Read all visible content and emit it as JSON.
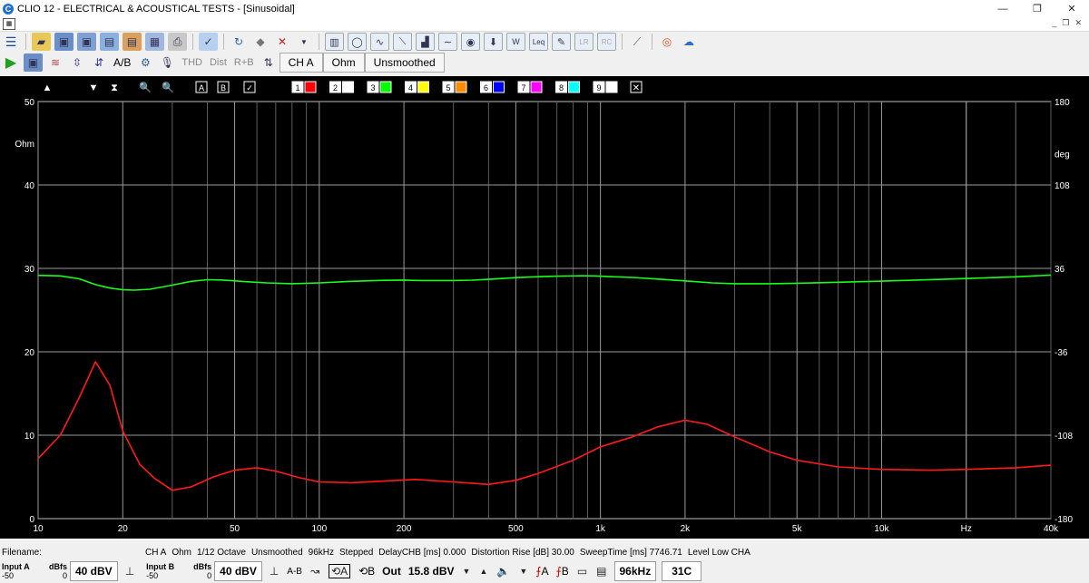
{
  "window": {
    "title": "CLIO 12 - ELECTRICAL & ACOUSTICAL TESTS - [Sinusoidal]",
    "app_icon_letter": "C",
    "minimize": "—",
    "maximize": "❐",
    "close": "✕"
  },
  "toolbar2": {
    "thd": "THD",
    "dist": "Dist",
    "rb": "R+B",
    "channel": "CH A",
    "unit": "Ohm",
    "smoothing": "Unsmoothed",
    "ab_label": "A/B"
  },
  "plot_toolbar": {
    "buttons": [
      "▲",
      "▼",
      "⧗",
      "🔍",
      "🔍",
      "A",
      "B",
      "✓"
    ],
    "overlays": [
      "1",
      "2",
      "3",
      "4",
      "5",
      "6",
      "7",
      "8",
      "9"
    ],
    "overlay_colors": [
      "#ff0000",
      "#ffffff",
      "#00ff00",
      "#ffff00",
      "#ff8c00",
      "#0000ff",
      "#ff00ff",
      "#00ffff",
      "#ffffff"
    ],
    "clear": "✕"
  },
  "chart_data": {
    "type": "line",
    "xscale": "log",
    "xlim": [
      10,
      40000
    ],
    "ylim": [
      0,
      50
    ],
    "y2lim": [
      -180,
      180
    ],
    "ylabel": "Ohm",
    "y2label": "deg",
    "xlabel": "Hz",
    "grid": true,
    "x_ticks": [
      {
        "v": 10,
        "t": "10"
      },
      {
        "v": 20,
        "t": "20"
      },
      {
        "v": 50,
        "t": "50"
      },
      {
        "v": 100,
        "t": "100"
      },
      {
        "v": 200,
        "t": "200"
      },
      {
        "v": 500,
        "t": "500"
      },
      {
        "v": 1000,
        "t": "1k"
      },
      {
        "v": 2000,
        "t": "2k"
      },
      {
        "v": 5000,
        "t": "5k"
      },
      {
        "v": 10000,
        "t": "10k"
      },
      {
        "v": 20000,
        "t": "Hz"
      },
      {
        "v": 40000,
        "t": "40k"
      }
    ],
    "y_ticks": [
      {
        "v": 50,
        "t": "50"
      },
      {
        "v": 45,
        "t": "Ohm"
      },
      {
        "v": 40,
        "t": "40"
      },
      {
        "v": 30,
        "t": "30"
      },
      {
        "v": 20,
        "t": "20"
      },
      {
        "v": 10,
        "t": "10"
      },
      {
        "v": 0,
        "t": "0"
      }
    ],
    "y2_ticks": [
      {
        "v": 180,
        "t": "180"
      },
      {
        "v": 135,
        "t": "deg"
      },
      {
        "v": 108,
        "t": "108"
      },
      {
        "v": 36,
        "t": "36"
      },
      {
        "v": -36,
        "t": "-36"
      },
      {
        "v": -108,
        "t": "-108"
      },
      {
        "v": -180,
        "t": "-180"
      }
    ],
    "series": [
      {
        "axis": "left",
        "color": "#ff1a1a",
        "points": [
          [
            10,
            7.2
          ],
          [
            12,
            10
          ],
          [
            14,
            14.5
          ],
          [
            16,
            18.8
          ],
          [
            18,
            16
          ],
          [
            20,
            10.5
          ],
          [
            23,
            6.5
          ],
          [
            26,
            4.8
          ],
          [
            30,
            3.4
          ],
          [
            35,
            3.8
          ],
          [
            42,
            5
          ],
          [
            50,
            5.8
          ],
          [
            60,
            6.1
          ],
          [
            70,
            5.7
          ],
          [
            85,
            4.9
          ],
          [
            100,
            4.4
          ],
          [
            130,
            4.3
          ],
          [
            170,
            4.5
          ],
          [
            220,
            4.7
          ],
          [
            300,
            4.4
          ],
          [
            400,
            4.1
          ],
          [
            500,
            4.6
          ],
          [
            600,
            5.4
          ],
          [
            800,
            7
          ],
          [
            1000,
            8.6
          ],
          [
            1300,
            9.8
          ],
          [
            1600,
            11
          ],
          [
            2000,
            11.8
          ],
          [
            2400,
            11.3
          ],
          [
            3000,
            9.8
          ],
          [
            4000,
            8
          ],
          [
            5000,
            7
          ],
          [
            7000,
            6.2
          ],
          [
            10000,
            5.9
          ],
          [
            15000,
            5.8
          ],
          [
            20000,
            5.9
          ],
          [
            30000,
            6.1
          ],
          [
            40000,
            6.4
          ]
        ]
      },
      {
        "axis": "right",
        "color": "#1aff1a",
        "points": [
          [
            10,
            30
          ],
          [
            12,
            29.5
          ],
          [
            14,
            27
          ],
          [
            16,
            22
          ],
          [
            18,
            19
          ],
          [
            20,
            17.5
          ],
          [
            22,
            17.2
          ],
          [
            25,
            18
          ],
          [
            30,
            21.5
          ],
          [
            35,
            24.8
          ],
          [
            40,
            26.2
          ],
          [
            45,
            26
          ],
          [
            55,
            24.5
          ],
          [
            65,
            23.5
          ],
          [
            80,
            22.8
          ],
          [
            100,
            23.5
          ],
          [
            130,
            24.8
          ],
          [
            170,
            25.7
          ],
          [
            200,
            25.9
          ],
          [
            230,
            25.5
          ],
          [
            300,
            25.5
          ],
          [
            350,
            25.8
          ],
          [
            400,
            26.5
          ],
          [
            500,
            28
          ],
          [
            600,
            28.8
          ],
          [
            700,
            29.3
          ],
          [
            850,
            29.6
          ],
          [
            950,
            29.5
          ],
          [
            1100,
            28.8
          ],
          [
            1300,
            28.2
          ],
          [
            1600,
            26.8
          ],
          [
            2000,
            25.2
          ],
          [
            2500,
            23.5
          ],
          [
            3000,
            22.8
          ],
          [
            4000,
            22.8
          ],
          [
            5000,
            23.2
          ],
          [
            7000,
            24
          ],
          [
            10000,
            25
          ],
          [
            15000,
            26.3
          ],
          [
            20000,
            27.2
          ],
          [
            30000,
            28.7
          ],
          [
            40000,
            30.2
          ]
        ]
      }
    ]
  },
  "info": {
    "filename_label": "Filename:",
    "channel": "CH A",
    "unit": "Ohm",
    "octave": "1/12 Octave",
    "smoothing": "Unsmoothed",
    "rate": "96kHz",
    "mode": "Stepped",
    "delay": "DelayCHB [ms] 0.000",
    "dist_rise": "Distortion Rise [dB] 30.00",
    "sweep": "SweepTime [ms] 7746.71",
    "level": "Level Low CHA"
  },
  "status": {
    "inputA": {
      "label": "Input A",
      "unit": "dBfs",
      "min": "-50",
      "max": "0",
      "level": "40 dBV"
    },
    "inputB": {
      "label": "Input B",
      "unit": "dBfs",
      "min": "-50",
      "max": "0",
      "level": "40 dBV"
    },
    "ab": "A-B",
    "out_label": "Out",
    "out_level": "15.8 dBV",
    "srate": "96kHz",
    "temp": "31C",
    "chb_label": "B",
    "fa_label": "A",
    "fb_label": "B"
  }
}
